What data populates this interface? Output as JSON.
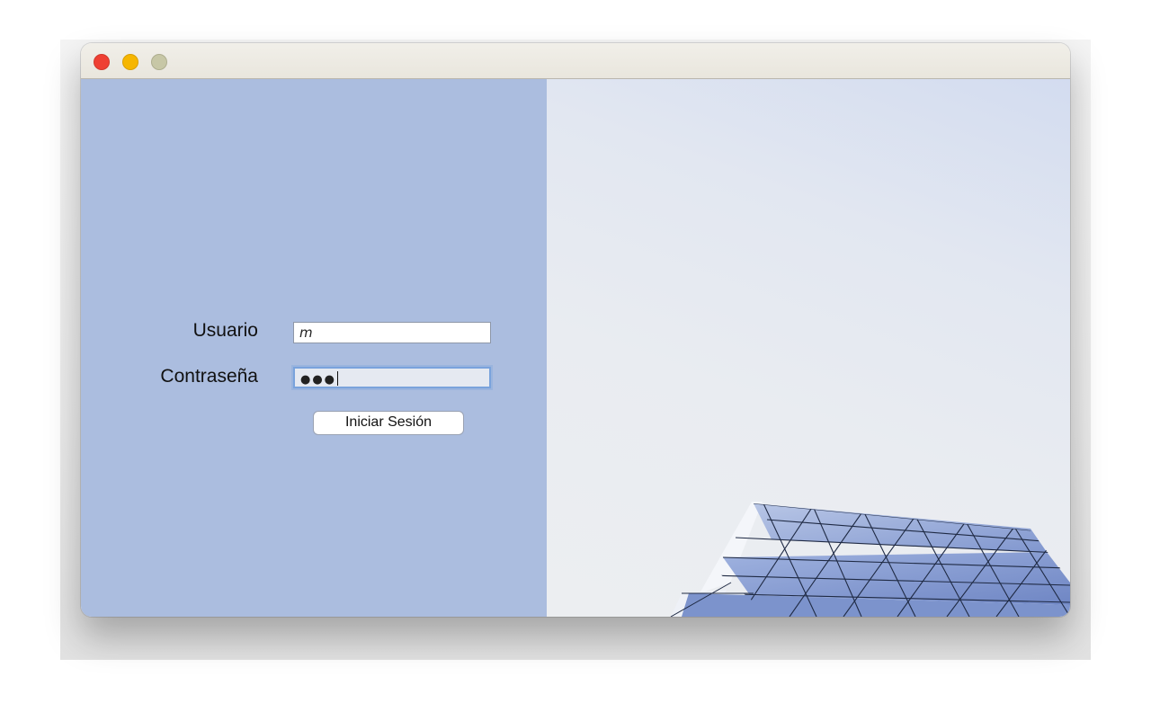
{
  "window": {
    "controls": [
      "close",
      "minimize",
      "zoom"
    ]
  },
  "login": {
    "user_label": "Usuario",
    "user_value": "m",
    "password_label": "Contraseña",
    "password_mask": "●●●",
    "submit_label": "Iniciar Sesión"
  },
  "colors": {
    "left_panel": "#abbddf",
    "accent_focus": "#7aa3dc",
    "close": "#ef4033",
    "minimize": "#f6b600",
    "zoom": "#c7c7a6"
  },
  "image": {
    "subject": "glass-building-facade"
  }
}
